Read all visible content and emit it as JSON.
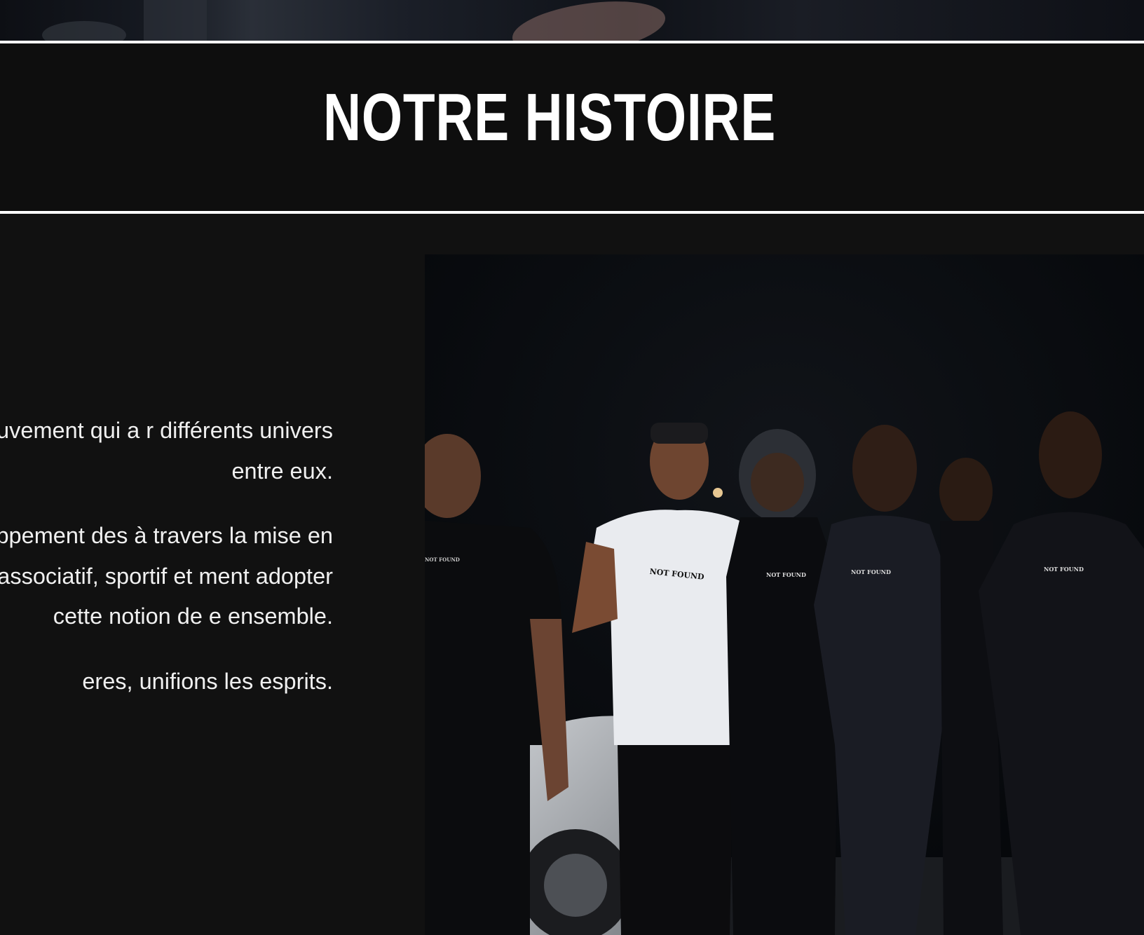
{
  "page": {
    "title": "NOTRE HISTOIRE"
  },
  "story": {
    "paragraphs": [
      "lity est un mouvement qui a r différents univers entre eux.",
      "sse au développement des à travers la mise en place iques, associatif, sportif et ment adopter cette notion de e ensemble.",
      "eres, unifions les esprits."
    ]
  },
  "photo": {
    "shirt_labels": [
      "NOT FOUND",
      "NOT FOUND",
      "NOT FOUND",
      "NOT FOUND",
      "NOT FOUND"
    ]
  },
  "colors": {
    "background": "#111111",
    "rule": "#ffffff",
    "text": "#f0f0f0"
  }
}
